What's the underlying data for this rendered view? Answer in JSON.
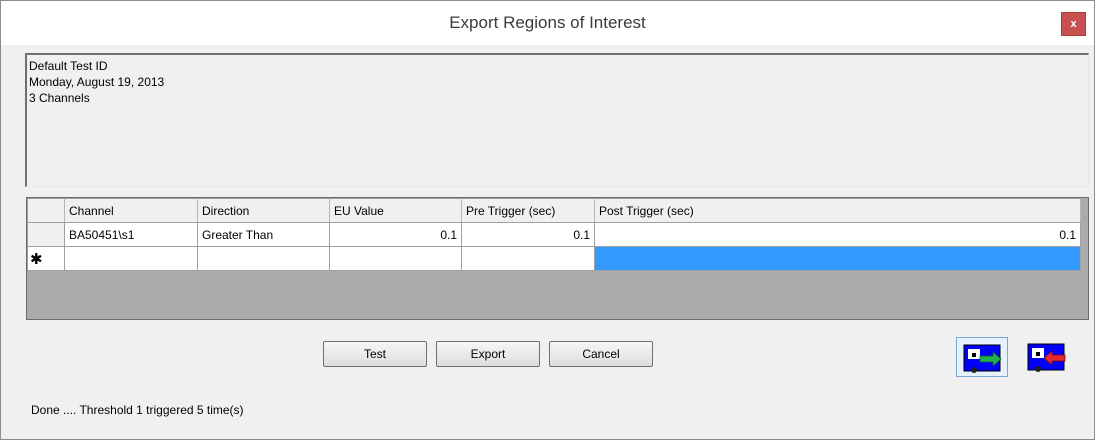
{
  "window": {
    "title": "Export Regions of Interest",
    "close_label": "x"
  },
  "info": {
    "lines": [
      "Default Test ID",
      "Monday, August 19, 2013",
      "3 Channels"
    ]
  },
  "grid": {
    "columns": [
      "Channel",
      "Direction",
      "EU Value",
      "Pre Trigger (sec)",
      "Post Trigger (sec)"
    ],
    "rows": [
      {
        "channel": "BA50451\\s1",
        "direction": "Greater Than",
        "eu_value": "0.1",
        "pre_trigger": "0.1",
        "post_trigger": "0.1"
      }
    ],
    "new_row_marker": "✱"
  },
  "buttons": {
    "test": "Test",
    "export": "Export",
    "cancel": "Cancel"
  },
  "icons": {
    "left": "import-arrow-icon",
    "right": "export-arrow-icon"
  },
  "colors": {
    "selection": "#3399ff",
    "close_button": "#c75050",
    "icon_blue": "#0000ff",
    "icon_green_arrow": "#22b24c",
    "icon_red_arrow": "#e8262d"
  },
  "status": "Done .... Threshold 1 triggered 5 time(s)"
}
